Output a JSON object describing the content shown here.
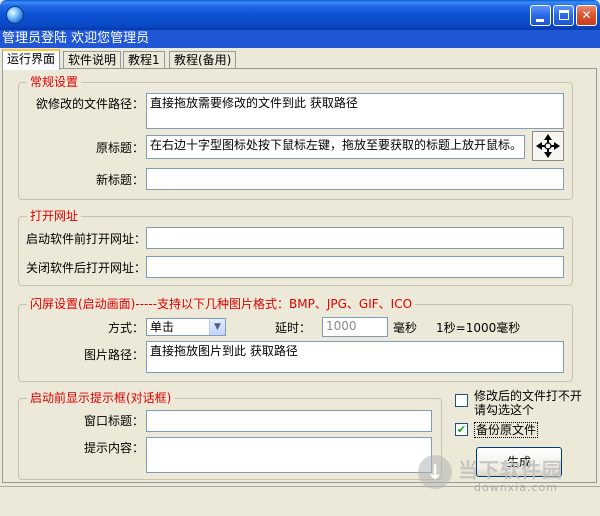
{
  "window": {
    "header_text": "管理员登陆 欢迎您管理员"
  },
  "tabs": [
    {
      "label": "运行界面",
      "active": true
    },
    {
      "label": "软件说明"
    },
    {
      "label": "教程1"
    },
    {
      "label": "教程(备用)"
    }
  ],
  "general": {
    "title": "常规设置",
    "file_path_label": "欲修改的文件路径：",
    "file_path_value": "直接拖放需要修改的文件到此 获取路径",
    "orig_title_label": "原标题：",
    "orig_title_value": "在右边十字型图标处按下鼠标左键，拖放至要获取的标题上放开鼠标。",
    "new_title_label": "新标题：",
    "new_title_value": ""
  },
  "open_url": {
    "title": "打开网址",
    "before_label": "启动软件前打开网址：",
    "before_value": "",
    "after_label": "关闭软件后打开网址：",
    "after_value": ""
  },
  "splash": {
    "title": "闪屏设置(启动画面)-----支持以下几种图片格式：BMP、JPG、GIF、ICO",
    "mode_label": "方式：",
    "mode_value": "单击",
    "delay_label": "延时：",
    "delay_value": "1000",
    "delay_unit": "毫秒",
    "delay_note": "1秒=1000毫秒",
    "image_path_label": "图片路径：",
    "image_path_value": "直接拖放图片到此 获取路径"
  },
  "dialog": {
    "title": "启动前显示提示框(对话框)",
    "window_title_label": "窗口标题：",
    "window_title_value": "",
    "content_label": "提示内容：",
    "content_value": ""
  },
  "options": {
    "prompt_label": "修改后的文件打不开请勾选这个",
    "prompt_checked": false,
    "backup_label": "备份原文件",
    "backup_checked": true,
    "generate_label": "生成"
  },
  "watermark": {
    "text": "当下软件园",
    "domain": "downxia.com"
  },
  "icons": {
    "close": "✕",
    "dropdown": "▼",
    "check": "✔",
    "download": "↓"
  },
  "colors": {
    "titlebar": "#0a49c6",
    "group_title": "#e00000",
    "tab_active_accent": "#ffc83c"
  }
}
